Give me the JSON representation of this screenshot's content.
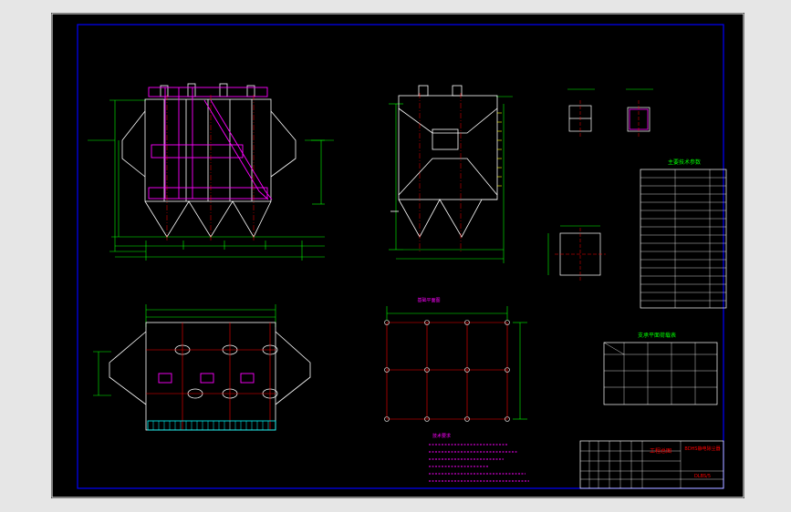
{
  "drawing": {
    "background_color": "#000000",
    "viewport_color": "#e6e6e6",
    "colors": {
      "frame": "#ffffff",
      "border": "#0000ff",
      "outline": "#ffffff",
      "dimension": "#00ff00",
      "center": "#ff0000",
      "highlight": "#ff00ff",
      "accent": "#00ffff",
      "yellow": "#ffff00"
    },
    "sheet_code": "DLBS/5",
    "title_block": {
      "project": "工程总图",
      "company": "BDHS静电除尘器"
    },
    "tech_params_title": "主要技术参数",
    "support_table_title": "支承平面荷载表",
    "notes_title": "技术要求",
    "plan_title": "基础平面图"
  }
}
